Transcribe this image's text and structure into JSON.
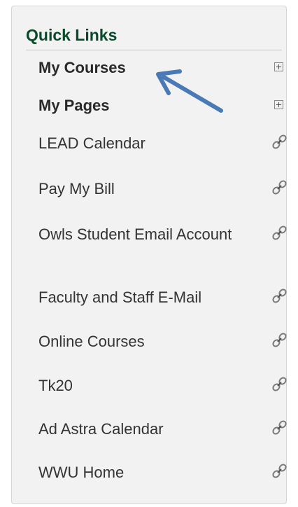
{
  "quick_links": {
    "title": "Quick Links",
    "items": [
      {
        "label": "My Courses",
        "type": "expand"
      },
      {
        "label": "My Pages",
        "type": "expand"
      },
      {
        "label": "LEAD Calendar",
        "type": "link"
      },
      {
        "label": "Pay My Bill",
        "type": "link"
      },
      {
        "label": "Owls Student Email Account",
        "type": "link"
      },
      {
        "label": "Faculty and Staff E-Mail",
        "type": "link"
      },
      {
        "label": "Online Courses",
        "type": "link"
      },
      {
        "label": "Tk20",
        "type": "link"
      },
      {
        "label": "Ad Astra Calendar",
        "type": "link"
      },
      {
        "label": "WWU Home",
        "type": "link"
      }
    ]
  },
  "icons": {
    "expand": "expand-plus-icon",
    "link": "chain-link-icon",
    "annotation": "arrow-annotation-icon"
  },
  "colors": {
    "title": "#0a4a2a",
    "panel_background": "#f2f2f2",
    "link_text": "#333333",
    "arrow": "#4a7ab5"
  }
}
